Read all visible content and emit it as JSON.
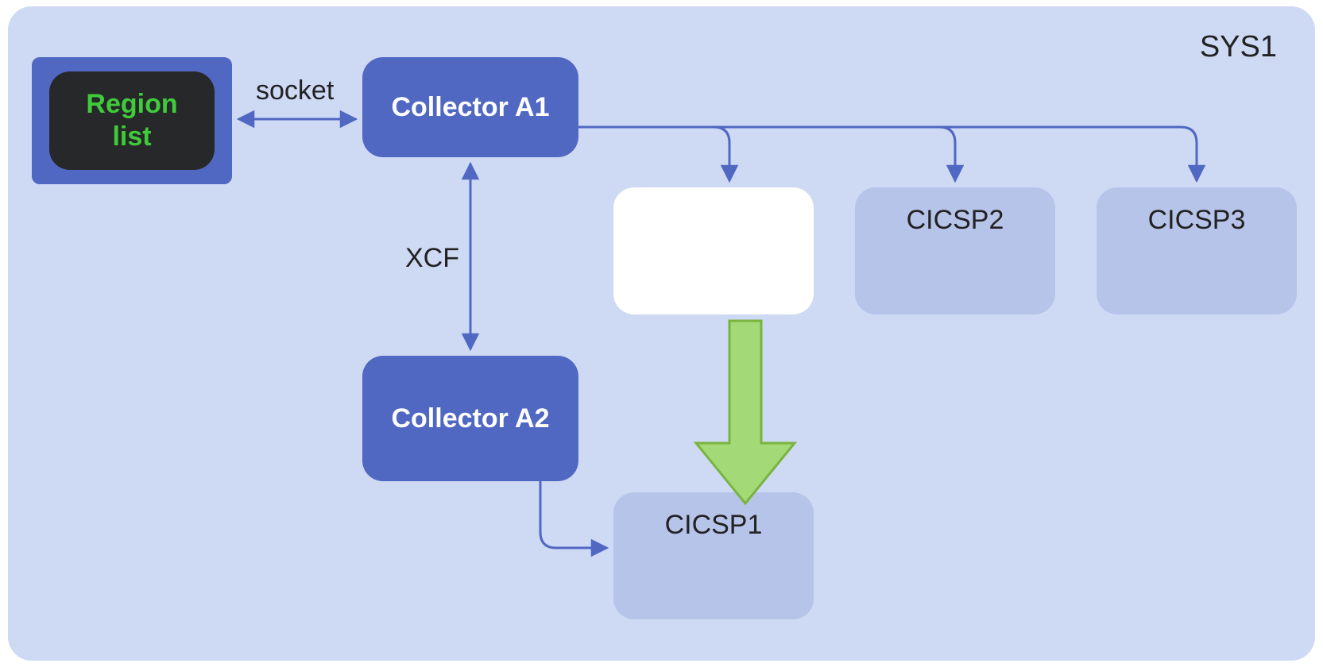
{
  "system": {
    "label": "SYS1"
  },
  "nodes": {
    "region_list": "Region\nlist",
    "collector_a1": "Collector A1",
    "collector_a2": "Collector A2",
    "cicsp1": "CICSP1",
    "cicsp2": "CICSP2",
    "cicsp3": "CICSP3"
  },
  "links": {
    "socket": "socket",
    "xcf": "XCF"
  },
  "colors": {
    "panel": "#ced9f4",
    "node_primary": "#5168c3",
    "node_secondary": "#b7c4ea",
    "region_core": "#26282a",
    "region_text": "#3fcb3a",
    "arrow": "#5168c3",
    "big_arrow_fill": "#a3d977",
    "big_arrow_stroke": "#78b43e"
  }
}
